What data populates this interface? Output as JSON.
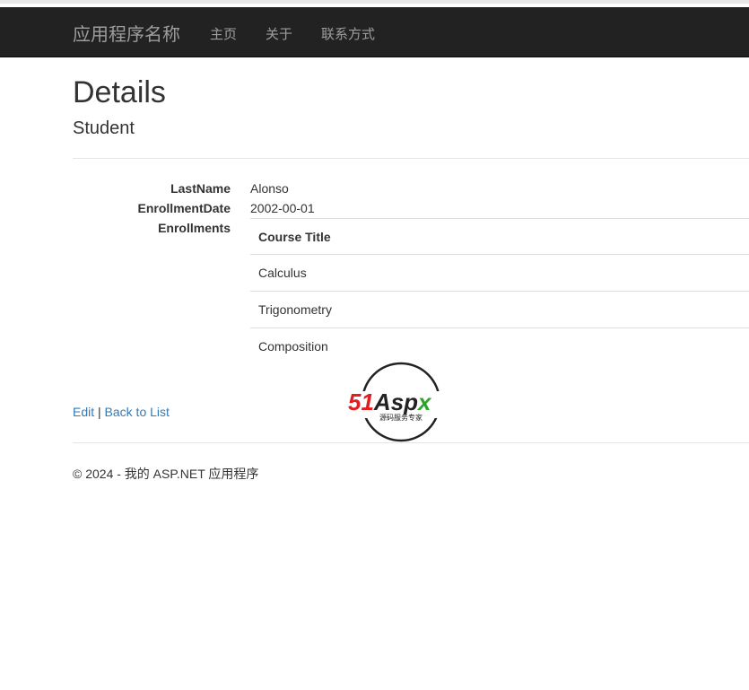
{
  "navbar": {
    "brand": "应用程序名称",
    "links": [
      "主页",
      "关于",
      "联系方式"
    ]
  },
  "page": {
    "title": "Details",
    "subtitle": "Student"
  },
  "details": {
    "lastname_label": "LastName",
    "lastname_value": "Alonso",
    "enrollmentdate_label": "EnrollmentDate",
    "enrollmentdate_value": "2002-00-01",
    "enrollments_label": "Enrollments"
  },
  "enrollments_table": {
    "header": "Course Title",
    "rows": [
      "Calculus",
      "Trigonometry",
      "Composition"
    ]
  },
  "actions": {
    "edit": "Edit",
    "separator": "|",
    "back": "Back to List"
  },
  "watermark": {
    "logo_text": "51Aspx",
    "logo_subtext": "源码服务专家"
  },
  "footer": {
    "text": "© 2024 - 我的 ASP.NET 应用程序"
  }
}
